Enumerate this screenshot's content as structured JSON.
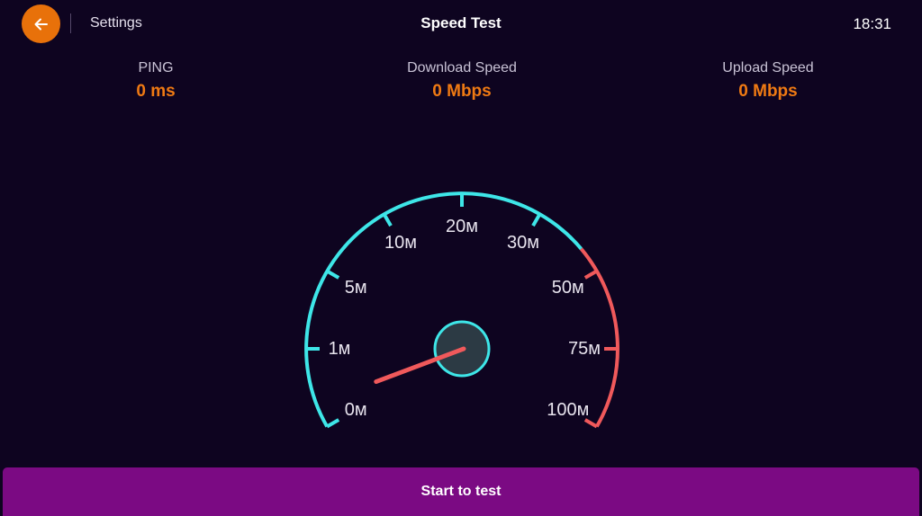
{
  "header": {
    "back_icon": "arrow-left-icon",
    "settings_label": "Settings",
    "title": "Speed Test",
    "clock": "18:31"
  },
  "metrics": {
    "ping": {
      "label": "PING",
      "value": "0 ms"
    },
    "download": {
      "label": "Download Speed",
      "value": "0 Mbps"
    },
    "upload": {
      "label": "Upload Speed",
      "value": "0 Mbps"
    }
  },
  "gauge": {
    "ticks": [
      "0м",
      "1м",
      "5м",
      "10м",
      "20м",
      "30м",
      "50м",
      "75м",
      "100м"
    ],
    "current_speed_mbps": 0,
    "colors": {
      "normal": "#3ee6e8",
      "high": "#f0595b",
      "needle": "#f0595b",
      "hub_fill": "#2c3a44",
      "hub_ring": "#3ee6e8",
      "tick_text": "#e8e4ee"
    }
  },
  "colors": {
    "background": "#0e0420",
    "accent": "#ef7a13",
    "button": "#7b0a83"
  },
  "start_button": {
    "label": "Start to test"
  }
}
